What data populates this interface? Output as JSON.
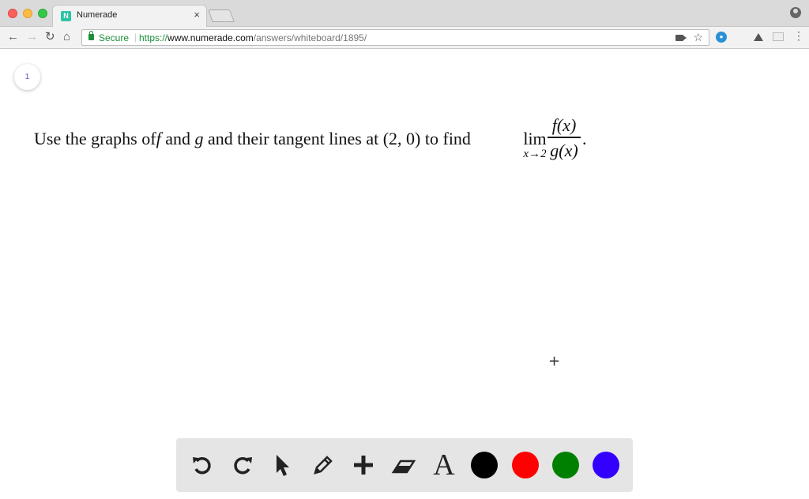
{
  "browser": {
    "tab_title": "Numerade",
    "tab_favicon_letter": "N",
    "secure_label": "Secure",
    "url_scheme": "https://",
    "url_host": "www.numerade.com",
    "url_path": "/answers/whiteboard/1895/"
  },
  "page": {
    "page_number": "1",
    "question": {
      "prefix": "Use the graphs of",
      "f": "f",
      "and": " and ",
      "g": "g",
      "suffix": " and their tangent lines at (2, 0) to find ",
      "lim": "lim",
      "lim_sub": "x→2",
      "numerator": "f(x)",
      "denominator": "g(x)",
      "period": "."
    }
  },
  "toolbar": {
    "tools": [
      "undo-icon",
      "redo-icon",
      "pointer-icon",
      "pencil-icon",
      "plus-icon",
      "eraser-icon",
      "text-icon"
    ],
    "text_tool_label": "A",
    "colors": [
      "#000000",
      "#ff0000",
      "#008000",
      "#3300ff"
    ]
  }
}
